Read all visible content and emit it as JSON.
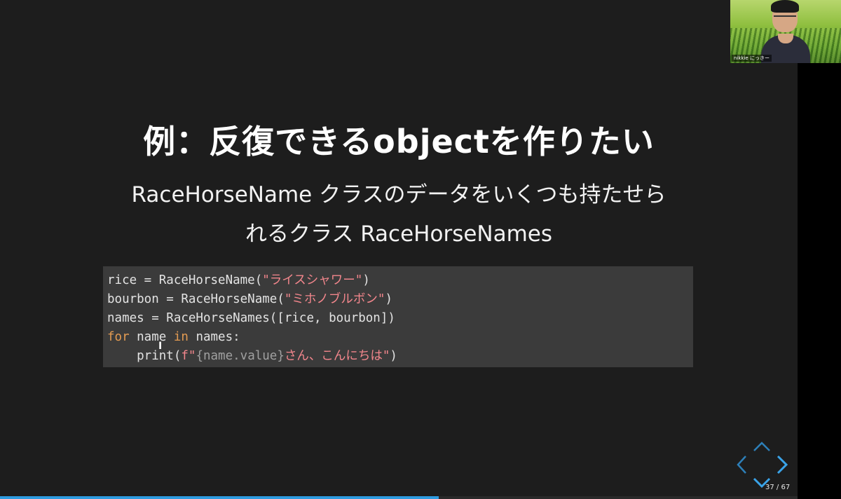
{
  "slide": {
    "title": "例：反復できるobjectを作りたい",
    "subtitle_line1": "RaceHorseName クラスのデータをいくつも持たせら",
    "subtitle_line2": "れるクラス RaceHorseNames"
  },
  "code": {
    "line1": {
      "pre": "rice = RaceHorseName(",
      "str": "\"ライスシャワー\"",
      "post": ")"
    },
    "line2": {
      "pre": "bourbon = RaceHorseName(",
      "str": "\"ミホノブルボン\"",
      "post": ")"
    },
    "line3": {
      "text": "names = RaceHorseNames([rice, bourbon])"
    },
    "line4": {
      "kw1": "for",
      "mid1": " name ",
      "kw2": "in",
      "mid2": " names:"
    },
    "line5": {
      "pre": "    print(",
      "str_open": "f\"",
      "interp": "{name.value}",
      "str_close": "さん、こんにちは\"",
      "post": ")"
    }
  },
  "webcam": {
    "label": "nikkie にっきー"
  },
  "pagination": {
    "text": "37 / 67",
    "current": 37,
    "total": 67
  },
  "progress": {
    "fraction": 0.55
  },
  "colors": {
    "accent": "#2e9be0",
    "string": "#f2868c",
    "keyword": "#e39b52"
  }
}
